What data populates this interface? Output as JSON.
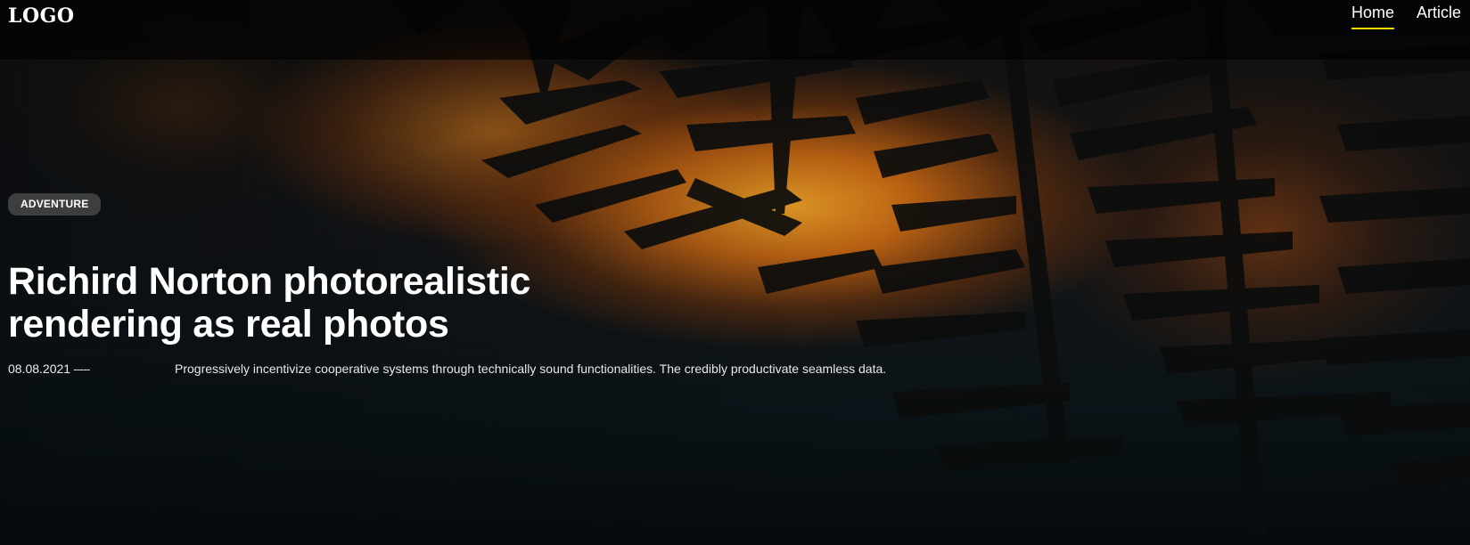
{
  "header": {
    "logo": "LOGO",
    "nav": [
      {
        "label": "Home",
        "active": true
      },
      {
        "label": "Article",
        "active": false
      }
    ],
    "active_underline_color": "#f2d600"
  },
  "hero": {
    "category_badge": "ADVENTURE",
    "title": "Richird Norton photorealistic rendering as real photos",
    "date": "08.08.2021",
    "date_separator": "-----",
    "excerpt": "Progressively incentivize cooperative systems through technically sound functionalities. The credibly productivate seamless data.",
    "background": "pine-branches-sunset-photo"
  }
}
